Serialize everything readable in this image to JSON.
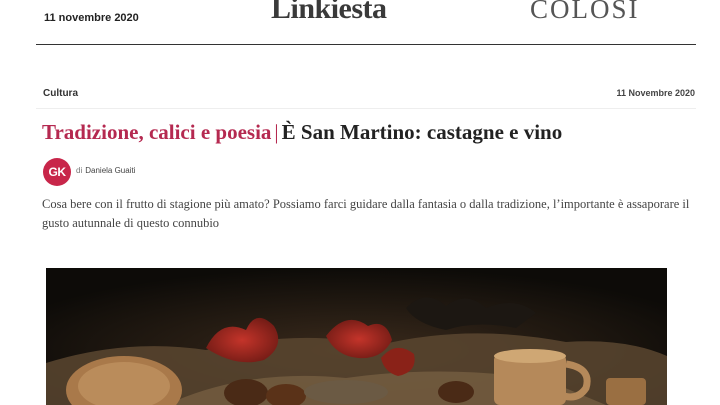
{
  "masthead": {
    "date": "11 novembre 2020",
    "logo": "Linkiesta",
    "sponsor": "COLOSI"
  },
  "article": {
    "section": "Cultura",
    "date": "11 Novembre 2020",
    "kicker": "Tradizione, calici e poesia",
    "separator": "|",
    "title": "È San Martino: castagne e vino",
    "author_initials": "GK",
    "byline_prefix": "di",
    "author": "Daniela Guaiti",
    "deck": "Cosa bere con il frutto di stagione più amato? Possiamo farci guidare dalla fantasia o dalla tradizione, l’importante è assaporare il gusto autunnale di questo connubio"
  },
  "colors": {
    "accent": "#b52950",
    "avatar_bg": "#c8264a"
  }
}
